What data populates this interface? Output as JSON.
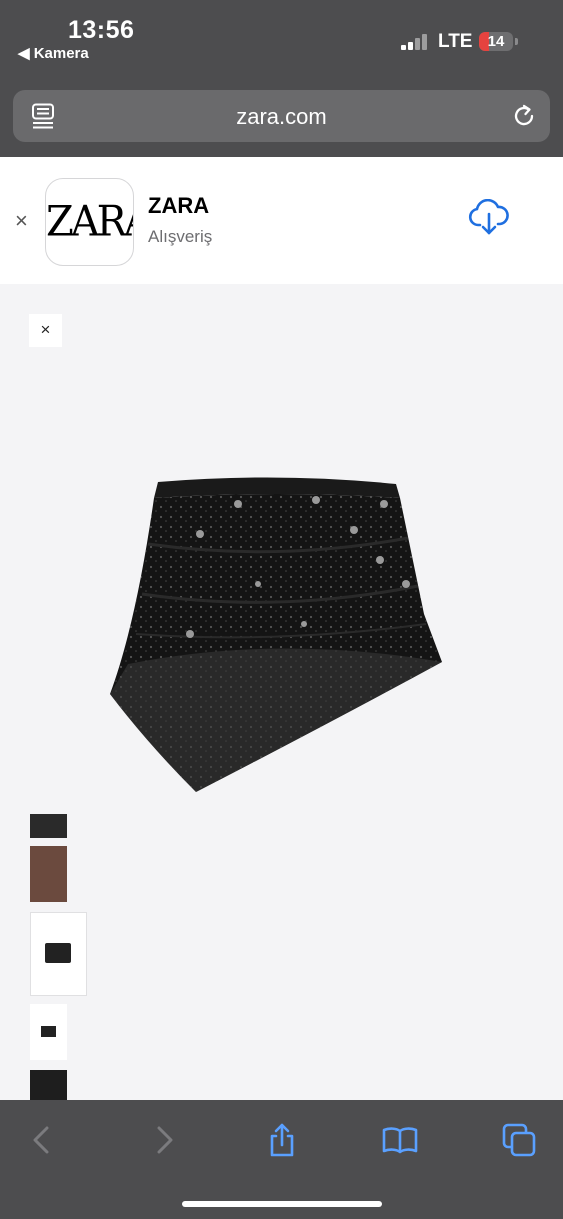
{
  "status": {
    "time": "13:56",
    "back_label": "◀ Kamera",
    "carrier": "LTE",
    "battery": "14"
  },
  "browser": {
    "url": "zara.com"
  },
  "app_banner": {
    "close": "×",
    "logo_text": "ZARA",
    "app_name": "ZARA",
    "category": "Alışveriş"
  },
  "viewer": {
    "close": "×",
    "main_image": "product-image-skirt",
    "thumbnails": [
      "thumb-1",
      "thumb-2",
      "thumb-3",
      "thumb-4",
      "thumb-5"
    ]
  },
  "toolbar": {
    "icons": [
      "back-icon",
      "forward-icon",
      "share-icon",
      "bookmarks-icon",
      "tabs-icon"
    ]
  },
  "colors": {
    "chrome": "#4d4d4f",
    "accent": "#1f6fe0",
    "battery_low": "#e5433f"
  }
}
